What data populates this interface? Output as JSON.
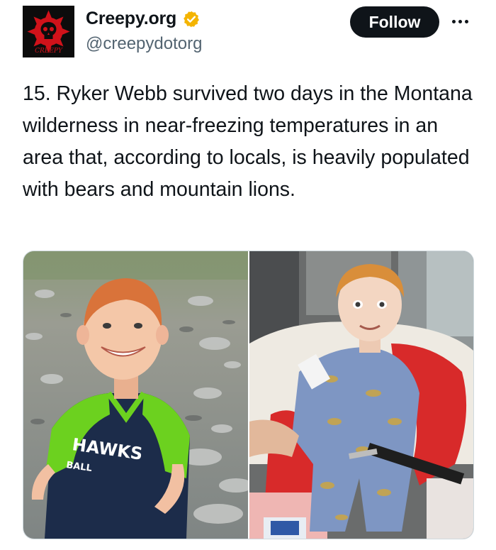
{
  "author": {
    "display_name": "Creepy.org",
    "handle": "@creepydotorg",
    "verified": true,
    "verified_color": "#f4b400",
    "avatar": {
      "icon": "skull-gear-logo",
      "logo_text": "CREEPY",
      "accent": "#d0121a",
      "background": "#0c0c0c"
    }
  },
  "actions": {
    "follow_label": "Follow",
    "more_icon": "ellipsis-icon"
  },
  "tweet": {
    "text": "15. Ryker Webb survived two days in the Montana wilderness in near-freezing temperatures in an area that, according to locals, is heavily populated with bears and mountain lions."
  },
  "media": {
    "photos": [
      {
        "description_icon": "photo-toddler-rocky-riverbank",
        "jersey_text": "HAWKS",
        "jersey_subtext": "BALL"
      },
      {
        "description_icon": "photo-toddler-hospital-stretcher"
      }
    ]
  }
}
